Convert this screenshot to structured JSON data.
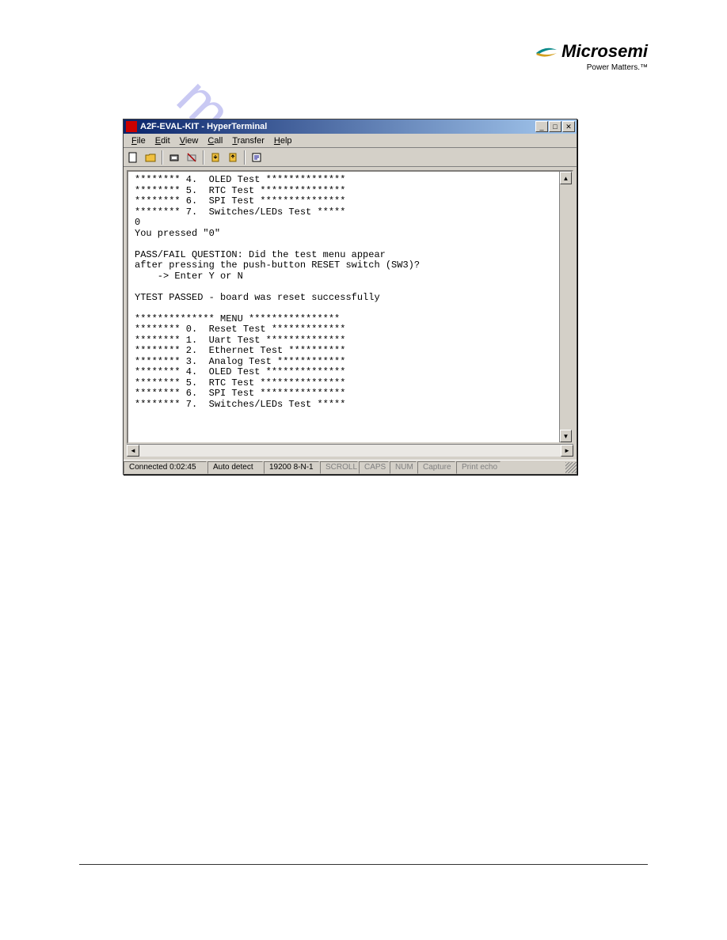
{
  "logo": {
    "brand": "Microsemi",
    "tagline": "Power Matters.™"
  },
  "watermark": "manualshive.com",
  "window": {
    "title": "A2F-EVAL-KIT - HyperTerminal",
    "menus": {
      "file": "File",
      "edit": "Edit",
      "view": "View",
      "call": "Call",
      "transfer": "Transfer",
      "help": "Help"
    },
    "titlebar_buttons": {
      "minimize": "_",
      "maximize": "□",
      "close": "✕"
    },
    "terminal_text": "******** 4.  OLED Test **************\n******** 5.  RTC Test ***************\n******** 6.  SPI Test ***************\n******** 7.  Switches/LEDs Test *****\n0\nYou pressed \"0\"\n\nPASS/FAIL QUESTION: Did the test menu appear\nafter pressing the push-button RESET switch (SW3)?\n    -> Enter Y or N\n\nYTEST PASSED - board was reset successfully\n\n************** MENU ****************\n******** 0.  Reset Test *************\n******** 1.  Uart Test **************\n******** 2.  Ethernet Test **********\n******** 3.  Analog Test ************\n******** 4.  OLED Test **************\n******** 5.  RTC Test ***************\n******** 6.  SPI Test ***************\n******** 7.  Switches/LEDs Test *****\n",
    "status": {
      "connected": "Connected 0:02:45",
      "autodetect": "Auto detect",
      "settings": "19200 8-N-1",
      "scroll": "SCROLL",
      "caps": "CAPS",
      "num": "NUM",
      "capture": "Capture",
      "printecho": "Print echo"
    }
  }
}
